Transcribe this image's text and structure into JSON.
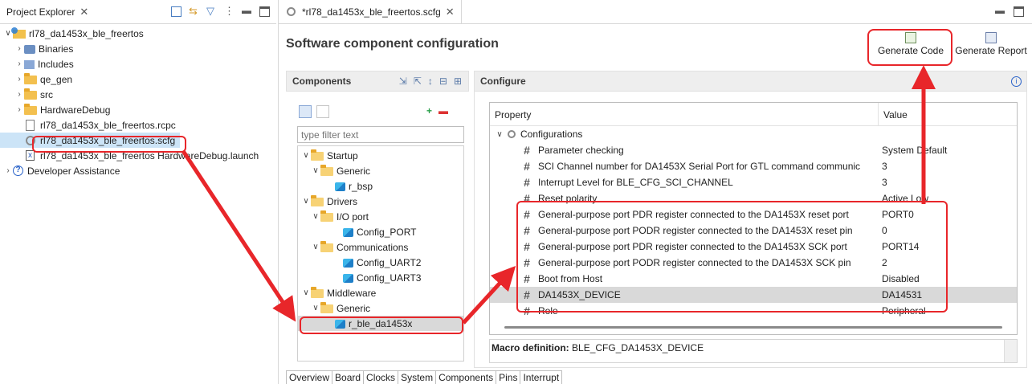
{
  "project_explorer": {
    "tab_label": "Project Explorer",
    "tree": [
      {
        "label": "rl78_da1453x_ble_freertos",
        "level": 0,
        "twisty": "open",
        "icon": "project-icon"
      },
      {
        "label": "Binaries",
        "level": 1,
        "twisty": "closed",
        "icon": "binaries-icon"
      },
      {
        "label": "Includes",
        "level": 1,
        "twisty": "closed",
        "icon": "includes-icon"
      },
      {
        "label": "qe_gen",
        "level": 1,
        "twisty": "closed",
        "icon": "folder-icon"
      },
      {
        "label": "src",
        "level": 1,
        "twisty": "closed",
        "icon": "folder-icon"
      },
      {
        "label": "HardwareDebug",
        "level": 1,
        "twisty": "closed",
        "icon": "folder-icon"
      },
      {
        "label": "rl78_da1453x_ble_freertos.rcpc",
        "level": 1,
        "twisty": "",
        "icon": "file-icon"
      },
      {
        "label": "rl78_da1453x_ble_freertos.scfg",
        "level": 1,
        "twisty": "",
        "icon": "gear-icon"
      },
      {
        "label": "rl78_da1453x_ble_freertos HardwareDebug.launch",
        "level": 1,
        "twisty": "",
        "icon": "launch-file-icon"
      },
      {
        "label": "Developer Assistance",
        "level": 0,
        "twisty": "closed",
        "icon": "help-icon"
      }
    ]
  },
  "editor": {
    "tab_label": "*rl78_da1453x_ble_freertos.scfg",
    "heading": "Software component configuration",
    "generate_code": "Generate Code",
    "generate_report": "Generate Report",
    "components_title": "Components",
    "filter_placeholder": "type filter text",
    "configure_title": "Configure",
    "components_tree": [
      {
        "label": "Startup",
        "level": 0,
        "type": "folder"
      },
      {
        "label": "Generic",
        "level": 1,
        "type": "folder"
      },
      {
        "label": "r_bsp",
        "level": 2,
        "type": "component"
      },
      {
        "label": "Drivers",
        "level": 0,
        "type": "folder"
      },
      {
        "label": "I/O port",
        "level": 1,
        "type": "folder"
      },
      {
        "label": "Config_PORT",
        "level": 2,
        "type": "component"
      },
      {
        "label": "Communications",
        "level": 1,
        "type": "folder"
      },
      {
        "label": "Config_UART2",
        "level": 2,
        "type": "component"
      },
      {
        "label": "Config_UART3",
        "level": 2,
        "type": "component"
      },
      {
        "label": "Middleware",
        "level": 0,
        "type": "folder"
      },
      {
        "label": "Generic",
        "level": 1,
        "type": "folder"
      },
      {
        "label": "r_ble_da1453x",
        "level": 2,
        "type": "component"
      }
    ],
    "property_header": "Property",
    "value_header": "Value",
    "configurations_label": "Configurations",
    "properties": [
      {
        "name": "Parameter checking",
        "value": "System Default"
      },
      {
        "name": "SCI Channel number for DA1453X Serial Port for GTL command communic",
        "value": "3"
      },
      {
        "name": "Interrupt Level for BLE_CFG_SCI_CHANNEL",
        "value": "3"
      },
      {
        "name": "Reset polarity",
        "value": "Active Low"
      },
      {
        "name": "General-purpose port PDR register connected to the DA1453X reset port",
        "value": "PORT0"
      },
      {
        "name": "General-purpose port PODR register connected to the DA1453X reset pin",
        "value": "0"
      },
      {
        "name": "General-purpose port PDR register connected to the DA1453X SCK port",
        "value": "PORT14"
      },
      {
        "name": "General-purpose port PODR register connected to the DA1453X SCK pin",
        "value": "2"
      },
      {
        "name": "Boot from Host",
        "value": "Disabled"
      },
      {
        "name": "DA1453X_DEVICE",
        "value": "DA14531"
      },
      {
        "name": "Role",
        "value": "Peripheral"
      }
    ],
    "macro_label": "Macro definition:",
    "macro_value": "BLE_CFG_DA1453X_DEVICE",
    "bottom_tabs": [
      "Overview",
      "Board",
      "Clocks",
      "System",
      "Components",
      "Pins",
      "Interrupt"
    ]
  },
  "colors": {
    "highlight_red": "#e8262a",
    "selection_blue": "#cce4f7",
    "header_gray": "#eeeeee"
  }
}
